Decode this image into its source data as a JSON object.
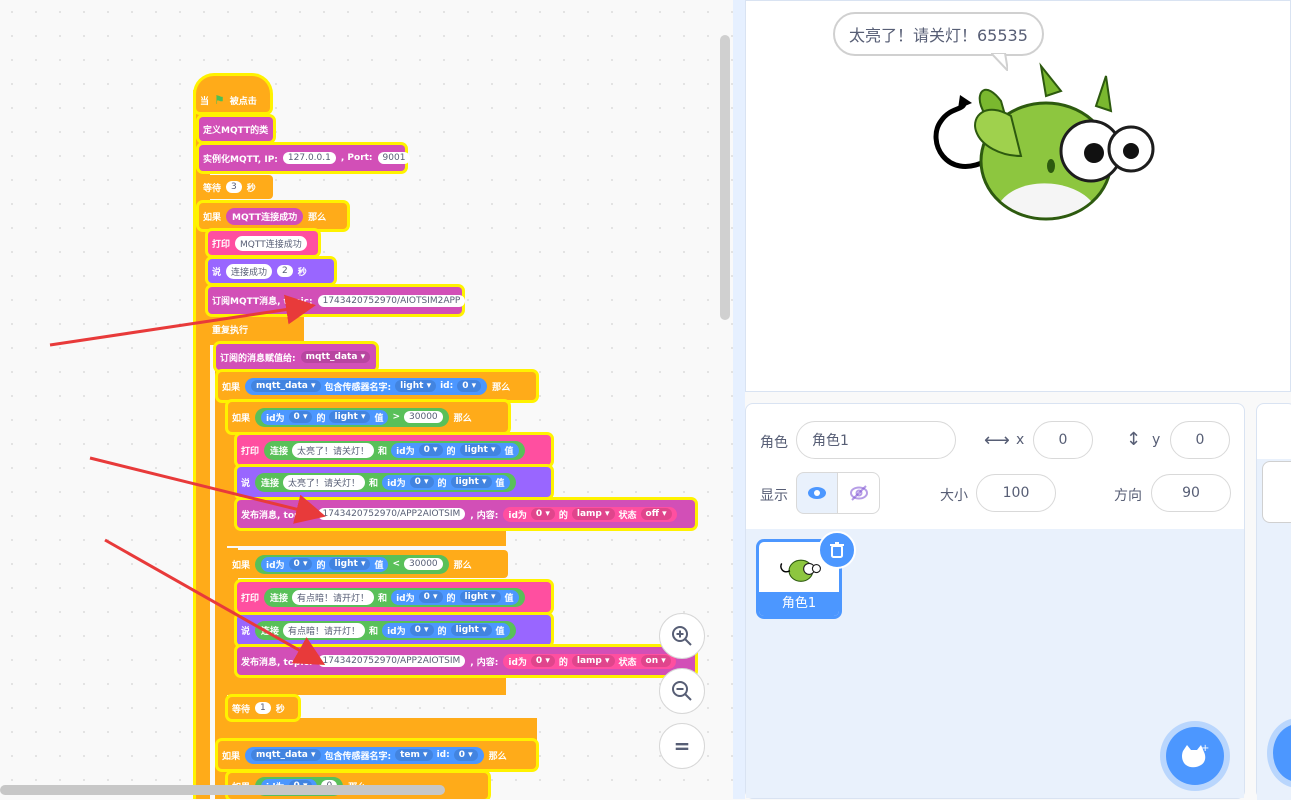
{
  "blocks": {
    "when_flag": "当",
    "when_flag_tail": "被点击",
    "define_mqtt": "定义MQTT的类",
    "instantiate": "实例化MQTT, IP:",
    "ip": "127.0.0.1",
    "port_label": ", Port:",
    "port": "9001",
    "wait": "等待",
    "wait_val1": "3",
    "sec": "秒",
    "if": "如果",
    "then": "那么",
    "connected_cond": "MQTT连接成功",
    "print": "打印",
    "print_val": "MQTT连接成功",
    "say": "说",
    "say_val": "连接成功",
    "say_secs": "2",
    "subscribe": "订阅MQTT消息, topic:",
    "subscribe_topic": "1743420752970/AIOTSIM2APP",
    "forever": "重复执行",
    "assign": "订阅的消息赋值给:",
    "var": "mqtt_data",
    "contains": "包含传感器名字:",
    "sensor_light": "light",
    "id_label": "id:",
    "id_val": "0",
    "idfor": "id为",
    "of": "的",
    "value": "值",
    "gt": ">",
    "lt": "<",
    "threshold": "30000",
    "join": "连接",
    "and": "和",
    "msg_bright": "太亮了！请关灯！",
    "msg_dark": "有点暗！请开灯！",
    "publish": "发布消息, topic:",
    "publish_topic": "1743420752970/APP2AIOTSIM",
    "content": ", 内容:",
    "lamp": "lamp",
    "state": "状态",
    "off": "off",
    "on": "on",
    "wait_val2": "1",
    "sensor_tem": "tem",
    "partial_if": "如果",
    "partial_cond_id": "id为",
    "partial_cond_val": "0",
    "partial_num": "0"
  },
  "zoom": {
    "in_icon": "zoom-in",
    "out_icon": "zoom-out",
    "reset": "="
  },
  "stage": {
    "bubble": "太亮了！请关灯！65535"
  },
  "sprite_info": {
    "sprite_label": "角色",
    "sprite_name": "角色1",
    "x_label": "x",
    "x": "0",
    "y_label": "y",
    "y": "0",
    "show_label": "显示",
    "size_label": "大小",
    "size": "100",
    "direction_label": "方向",
    "direction": "90"
  },
  "sprite_tile": {
    "name": "角色1"
  },
  "colors": {
    "events": "#ffab19",
    "control": "#ffab19",
    "mqtt": "#d24fb7",
    "looks": "#9966ff",
    "operator": "#59c059",
    "sensing": "#4c97ff",
    "print": "#ff4fa0",
    "highlight": "#fff200"
  }
}
